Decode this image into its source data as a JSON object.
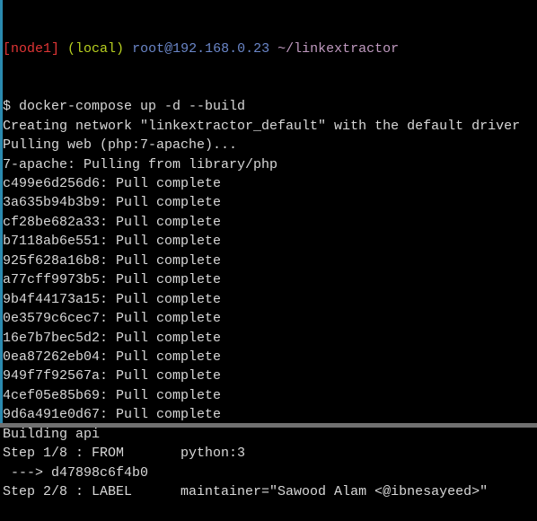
{
  "prompt": {
    "node": "[node1]",
    "env": "(local)",
    "host": "root@192.168.0.23",
    "path": "~/linkextractor"
  },
  "colors": {
    "node": "#e03535",
    "env": "#b8d020",
    "host": "#6a86c8",
    "path": "#c09ac0",
    "text": "#d8d8d8",
    "background": "#000000"
  },
  "lines": [
    "$ docker-compose up -d --build",
    "Creating network \"linkextractor_default\" with the default driver",
    "Pulling web (php:7-apache)...",
    "7-apache: Pulling from library/php",
    "c499e6d256d6: Pull complete",
    "3a635b94b3b9: Pull complete",
    "cf28be682a33: Pull complete",
    "b7118ab6e551: Pull complete",
    "925f628a16b8: Pull complete",
    "a77cff9973b5: Pull complete",
    "9b4f44173a15: Pull complete",
    "0e3579c6cec7: Pull complete",
    "16e7b7bec5d2: Pull complete",
    "0ea87262eb04: Pull complete",
    "949f7f92567a: Pull complete",
    "4cef05e85b69: Pull complete",
    "9d6a491e0d67: Pull complete",
    "Building api",
    "Step 1/8 : FROM       python:3",
    " ---> d47898c6f4b0",
    "Step 2/8 : LABEL      maintainer=\"Sawood Alam <@ibnesayeed>\""
  ]
}
